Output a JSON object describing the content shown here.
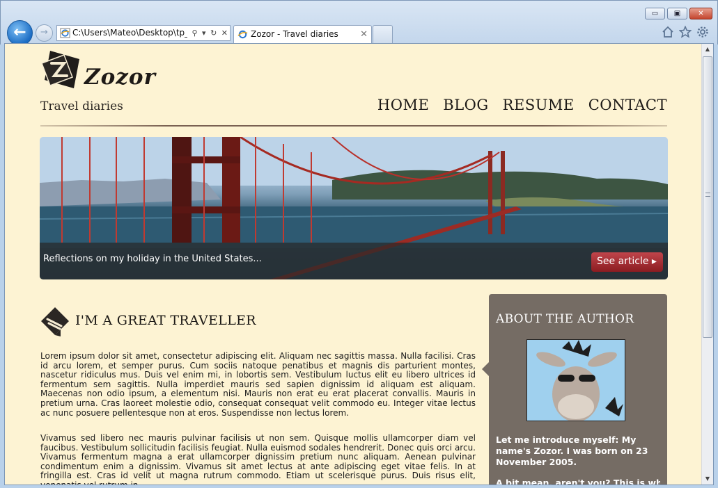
{
  "browser": {
    "address": "C:\\Users\\Mateo\\Desktop\\tp_f",
    "address_tools": [
      "⚲",
      "▾",
      "↻",
      "✕"
    ],
    "tab_title": "Zozor - Travel diaries",
    "tab_close": "✕",
    "window_buttons": {
      "minimize": "▭",
      "maximize": "▣",
      "close": "✕"
    },
    "back_label": "←",
    "forward_label": "→",
    "icons": [
      "home-icon",
      "star-icon",
      "gear-icon"
    ]
  },
  "site": {
    "title": "Zozor",
    "tagline": "Travel diaries",
    "nav": [
      "HOME",
      "BLOG",
      "RESUME",
      "CONTACT"
    ],
    "banner": {
      "caption": "Reflections on my holiday in the United States...",
      "button": "See article ▸"
    },
    "article": {
      "heading": "I'M A GREAT TRAVELLER",
      "paragraphs": [
        "Lorem ipsum dolor sit amet, consectetur adipiscing elit. Aliquam nec sagittis massa. Nulla facilisi. Cras id arcu lorem, et semper purus. Cum sociis natoque penatibus et magnis dis parturient montes, nascetur ridiculus mus. Duis vel enim mi, in lobortis sem. Vestibulum luctus elit eu libero ultrices id fermentum sem sagittis. Nulla imperdiet mauris sed sapien dignissim id aliquam est aliquam. Maecenas non odio ipsum, a elementum nisi. Mauris non erat eu erat placerat convallis. Mauris in pretium urna. Cras laoreet molestie odio, consequat consequat velit commodo eu. Integer vitae lectus ac nunc posuere pellentesque non at eros. Suspendisse non lectus lorem.",
        "Vivamus sed libero nec mauris pulvinar facilisis ut non sem. Quisque mollis ullamcorper diam vel faucibus. Vestibulum sollicitudin facilisis feugiat. Nulla euismod sodales hendrerit. Donec quis orci arcu. Vivamus fermentum magna a erat ullamcorper dignissim pretium nunc aliquam. Aenean pulvinar condimentum enim a dignissim. Vivamus sit amet lectus at ante adipiscing eget vitae felis. In at fringilla est. Cras id velit ut magna rutrum commodo. Etiam ut scelerisque purus. Duis risus elit, venenatis vel rutrum in,"
      ]
    },
    "aside": {
      "title": "ABOUT THE AUTHOR",
      "intro": "Let me introduce myself: My name's Zozor. I was born on 23 November 2005.",
      "more": "A bit mean, aren't you? This is why I"
    }
  },
  "colors": {
    "page_bg": "#fdf3d3",
    "aside_bg": "#756c64",
    "button_red": "#a82d33",
    "chrome_blue": "#c3d6ec"
  }
}
